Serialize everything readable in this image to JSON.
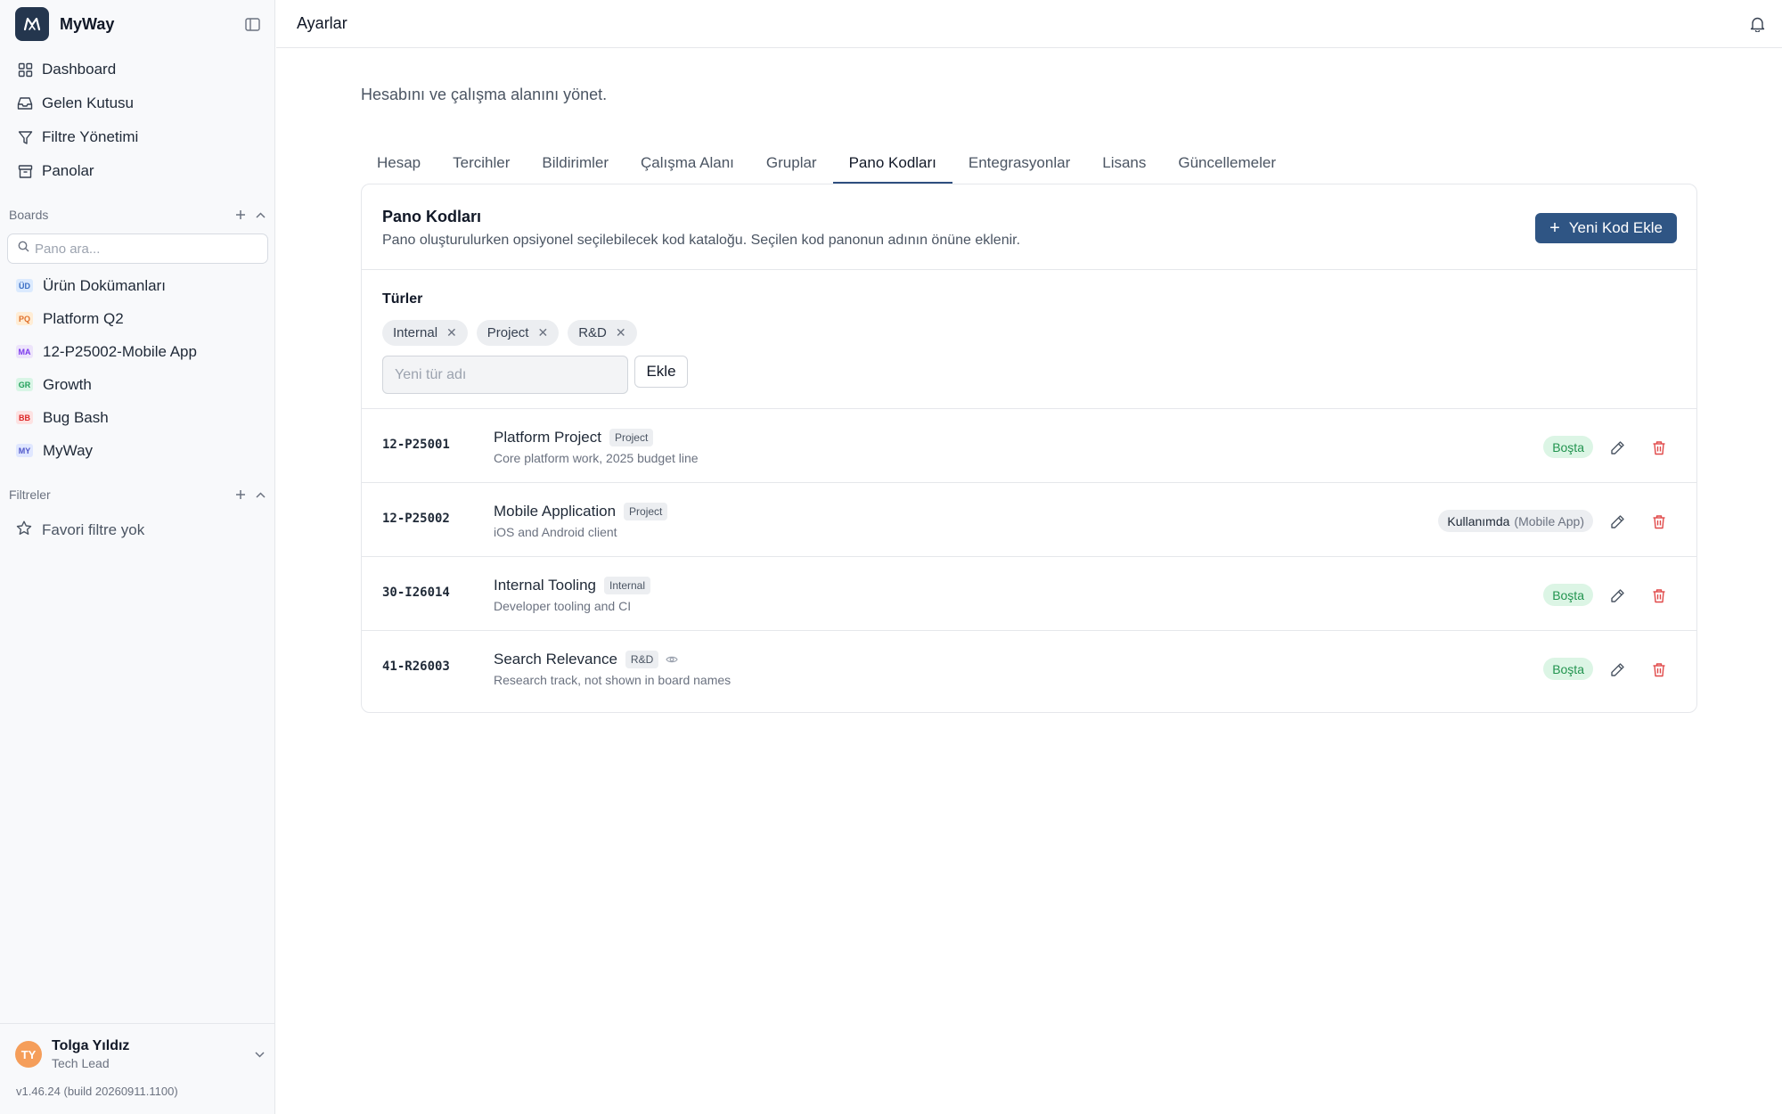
{
  "app": {
    "name": "MyWay"
  },
  "sidebar": {
    "nav": [
      {
        "label": "Dashboard",
        "icon": "dashboard-grid-icon"
      },
      {
        "label": "Gelen Kutusu",
        "icon": "inbox-icon"
      },
      {
        "label": "Filtre Yönetimi",
        "icon": "filter-icon"
      },
      {
        "label": "Panolar",
        "icon": "archive-box-icon"
      }
    ],
    "boards_title": "Boards",
    "board_search_placeholder": "Pano ara...",
    "boards": [
      {
        "badge": "ÜD",
        "label": "Ürün Dokümanları",
        "bg": "#dbeafe",
        "fg": "#3b6fc4"
      },
      {
        "badge": "PQ",
        "label": "Platform Q2",
        "bg": "#ffedd5",
        "fg": "#e0712c"
      },
      {
        "badge": "MA",
        "label": "12-P25002-Mobile App",
        "bg": "#ede4fb",
        "fg": "#7c3aed"
      },
      {
        "badge": "GR",
        "label": "Growth",
        "bg": "#d9f5e6",
        "fg": "#22a05a"
      },
      {
        "badge": "BB",
        "label": "Bug Bash",
        "bg": "#fde2e2",
        "fg": "#dc2626"
      },
      {
        "badge": "MY",
        "label": "MyWay",
        "bg": "#e0e7ff",
        "fg": "#4f56c9"
      }
    ],
    "filters_title": "Filtreler",
    "favorites_empty": "Favori filtre yok",
    "user": {
      "initials": "TY",
      "name": "Tolga Yıldız",
      "role": "Tech Lead"
    },
    "version": "v1.46.24 (build 20260911.1100)"
  },
  "header": {
    "title": "Ayarlar"
  },
  "main": {
    "subtitle": "Hesabını ve çalışma alanını yönet.",
    "tabs": [
      {
        "label": "Hesap"
      },
      {
        "label": "Tercihler"
      },
      {
        "label": "Bildirimler"
      },
      {
        "label": "Çalışma Alanı"
      },
      {
        "label": "Gruplar"
      },
      {
        "label": "Pano Kodları",
        "active": true
      },
      {
        "label": "Entegrasyonlar"
      },
      {
        "label": "Lisans"
      },
      {
        "label": "Güncellemeler"
      }
    ],
    "card": {
      "title": "Pano Kodları",
      "description": "Pano oluşturulurken opsiyonel seçilebilecek kod kataloğu. Seçilen kod panonun adının önüne eklenir.",
      "add_button": "Yeni Kod Ekle",
      "types_label": "Türler",
      "types": [
        "Internal",
        "Project",
        "R&D"
      ],
      "new_type_placeholder": "Yeni tür adı",
      "add_type_button": "Ekle",
      "codes": [
        {
          "code": "12-P25001",
          "name": "Platform Project",
          "type": "Project",
          "description": "Core platform work, 2025 budget line",
          "status": "Boşta",
          "in_use": false,
          "hidden": false
        },
        {
          "code": "12-P25002",
          "name": "Mobile Application",
          "type": "Project",
          "description": "iOS and Android client",
          "status": "Kullanımda",
          "status_app": "(Mobile App)",
          "in_use": true,
          "hidden": false
        },
        {
          "code": "30-I26014",
          "name": "Internal Tooling",
          "type": "Internal",
          "description": "Developer tooling and CI",
          "status": "Boşta",
          "in_use": false,
          "hidden": false
        },
        {
          "code": "41-R26003",
          "name": "Search Relevance",
          "type": "R&D",
          "description": "Research track, not shown in board names",
          "status": "Boşta",
          "in_use": false,
          "hidden": true
        }
      ]
    }
  },
  "colors": {
    "primary": "#2f5584",
    "logo_bg": "#24364e",
    "free_bg": "#dcf5e5",
    "free_fg": "#22944f",
    "danger": "#e04848"
  }
}
